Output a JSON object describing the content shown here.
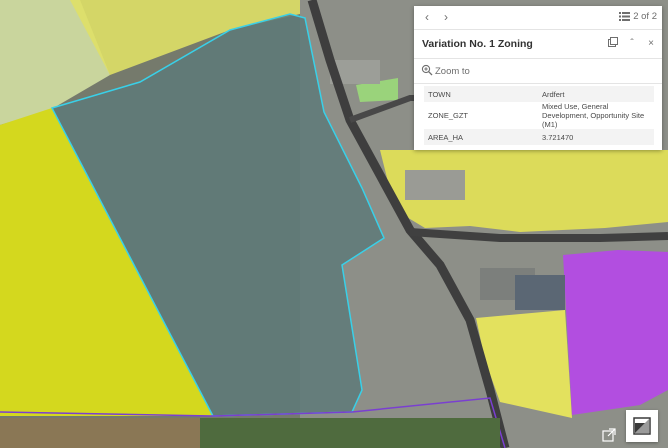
{
  "popup": {
    "pager": "2 of 2",
    "title": "Variation No. 1 Zoning",
    "zoom_label": "Zoom to",
    "rows": [
      {
        "key": "TOWN",
        "value": "Ardfert"
      },
      {
        "key": "ZONE_GZT",
        "value": "Mixed Use, General Development, Opportunity Site (M1)"
      },
      {
        "key": "AREA_HA",
        "value": "3.721470"
      }
    ]
  },
  "icons": {
    "prev": "chevron-left-icon",
    "next": "chevron-right-icon",
    "list": "feature-list-icon",
    "dock": "dock-icon",
    "collapse": "chevron-up-icon",
    "close": "close-icon",
    "zoom": "zoom-in-icon",
    "expand": "expand-icon",
    "external": "open-external-icon"
  },
  "colors": {
    "selection_outline": "#39d0e8",
    "selected_parcel_fill": "#5e7a79",
    "yellow_zone": "#e9e24a",
    "lime_zone": "#d8dc1e",
    "purple_zone": "#b34de3",
    "road": "#3e3e3e"
  }
}
